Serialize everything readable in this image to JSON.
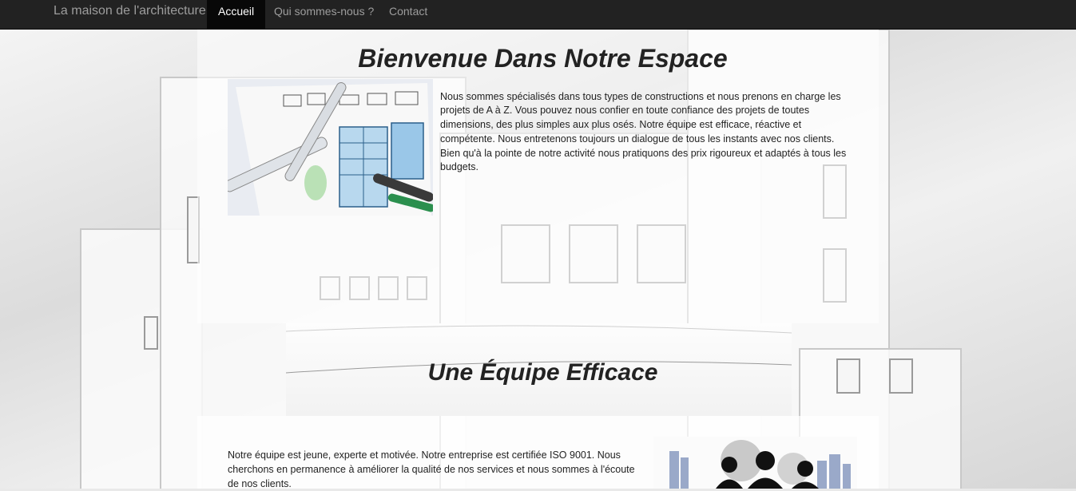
{
  "navbar": {
    "brand": "La maison de l'architecture",
    "items": [
      {
        "label": "Accueil",
        "active": true
      },
      {
        "label": "Qui sommes-nous ?",
        "active": false
      },
      {
        "label": "Contact",
        "active": false
      }
    ]
  },
  "section1": {
    "title": "Bienvenue Dans Notre Espace",
    "image": "architect-sketch-with-markers",
    "paragraph": "Nous sommes spécialisés dans tous types de constructions et nous prenons en charge les projets de A à Z. Vous pouvez nous confier en toute confiance des projets de toutes dimensions, des plus simples aux plus osés. Notre équipe est efficace, réactive et compétente. Nous entretenons toujours un dialogue de tous les instants avec nos clients. Bien qu'à la pointe de notre activité nous pratiquons des prix rigoureux et adaptés à tous les budgets."
  },
  "section2": {
    "title": "Une Équipe Efficace",
    "paragraph": "Notre équipe est jeune, experte et motivée. Notre entreprise est certifiée ISO 9001. Nous cherchons en permanence à améliorer la qualité de nos services et nous sommes à l'écoute de nos clients.",
    "image": "team-silhouettes-with-gears-and-city"
  },
  "colors": {
    "navbar_bg": "#222222",
    "nav_active_bg": "#080808",
    "nav_text": "#9d9d9d",
    "heading": "#222222"
  }
}
